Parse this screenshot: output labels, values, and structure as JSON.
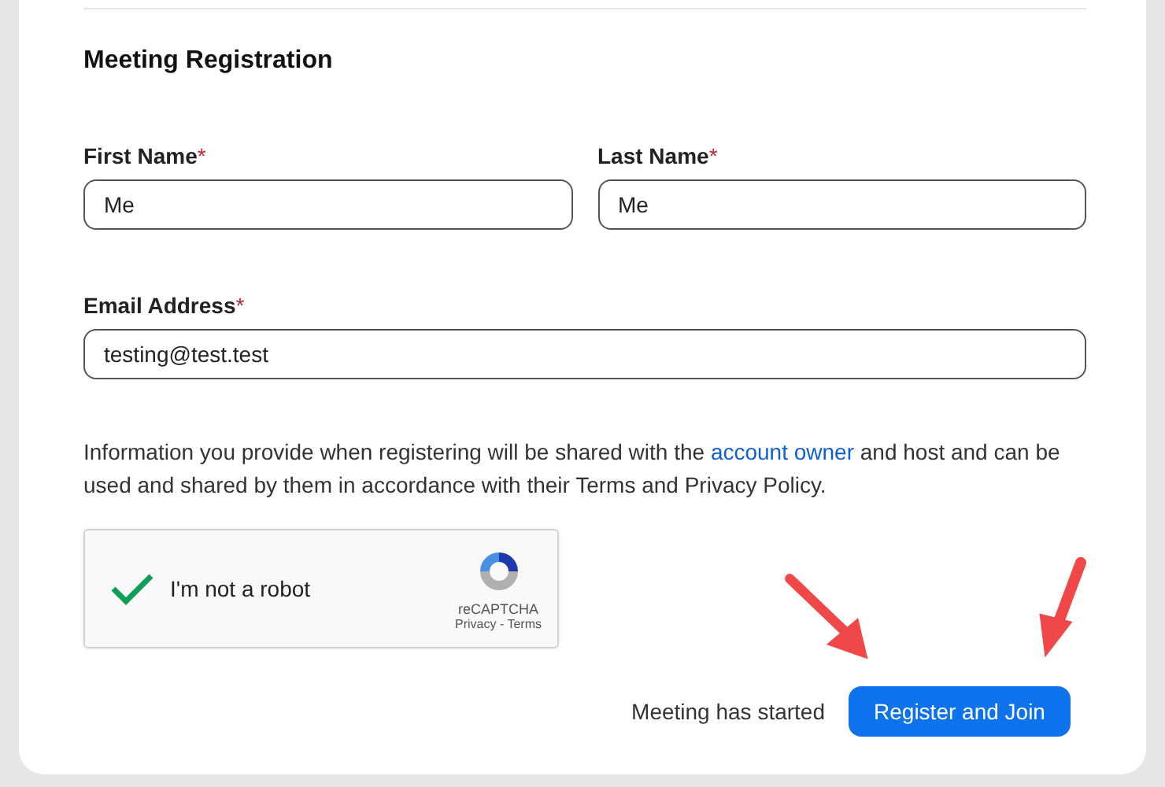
{
  "heading": "Meeting Registration",
  "fields": [
    {
      "label": "First Name",
      "required_mark": "*",
      "value": "Me"
    },
    {
      "label": "Last Name",
      "required_mark": "*",
      "value": "Me"
    },
    {
      "label": "Email Address",
      "required_mark": "*",
      "value": "testing@test.test"
    }
  ],
  "notice": [
    {
      "kind": "plain",
      "text": "Information you provide when registering will be shared with the "
    },
    {
      "kind": "link",
      "text": "account owner"
    },
    {
      "kind": "plain",
      "text": " and host and can be used and shared by them in accordance with their Terms and Privacy Policy."
    }
  ],
  "captcha": {
    "label": "I'm not a robot",
    "checked": true,
    "brand": "reCAPTCHA",
    "links": "Privacy - Terms"
  },
  "status": "Meeting has started",
  "submit": "Register and Join"
}
